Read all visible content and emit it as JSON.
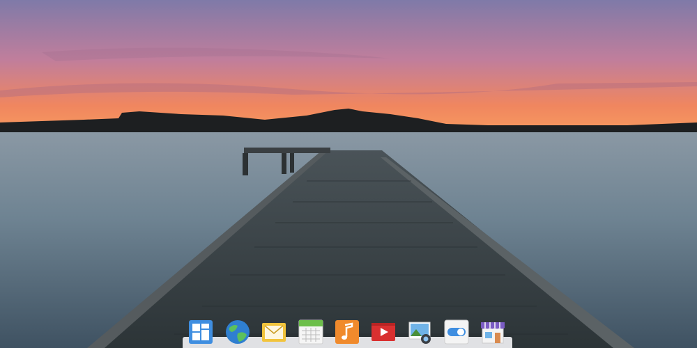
{
  "dock": {
    "items": [
      {
        "name": "multitasking-view",
        "icon": "multitasking-icon"
      },
      {
        "name": "web-browser",
        "icon": "globe-icon"
      },
      {
        "name": "mail",
        "icon": "mail-icon"
      },
      {
        "name": "calendar",
        "icon": "calendar-icon"
      },
      {
        "name": "music",
        "icon": "music-note-icon"
      },
      {
        "name": "videos",
        "icon": "video-play-icon"
      },
      {
        "name": "photos",
        "icon": "photos-icon"
      },
      {
        "name": "system-settings",
        "icon": "toggle-switch-icon"
      },
      {
        "name": "app-center",
        "icon": "storefront-icon"
      }
    ]
  },
  "colors": {
    "sky_top": "#8a7fb0",
    "sky_horizon": "#f58a5a",
    "water": "#6d8392",
    "dock": "#f0f0f3"
  }
}
